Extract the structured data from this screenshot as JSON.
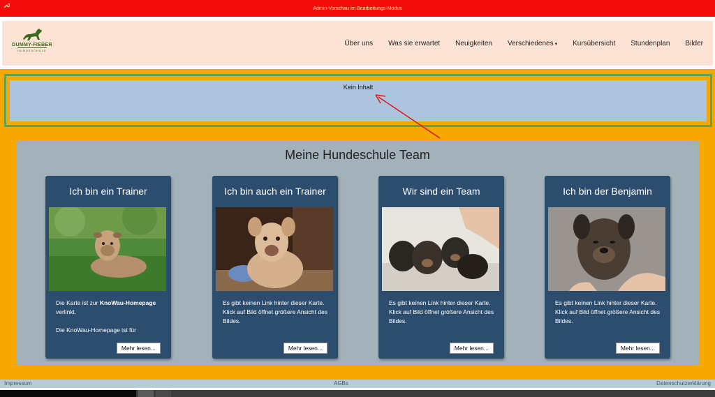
{
  "admin_bar": {
    "text": "Admin-Vorschau im Bearbeitungs-Modus",
    "icon": "wrench-icon"
  },
  "logo": {
    "brand": "DUMMY-FIEBER",
    "sub": "HUNDESCHULE"
  },
  "nav": {
    "items": [
      {
        "label": "Über uns"
      },
      {
        "label": "Was sie erwartet"
      },
      {
        "label": "Neuigkeiten"
      },
      {
        "label": "Verschiedenes"
      },
      {
        "label": "Kursübersicht"
      },
      {
        "label": "Stundenplan"
      },
      {
        "label": "Bilder"
      }
    ]
  },
  "empty_block": {
    "text": "Kein Inhalt"
  },
  "team": {
    "title": "Meine Hundeschule Team",
    "cards": [
      {
        "title": "Ich bin ein Trainer",
        "text_prefix": "Die Karte ist zur ",
        "text_bold": "KnoWau-Homepage",
        "text_suffix": " verlinkt.",
        "text_2": "Die KnoWau-Homepage ist für",
        "button": "Mehr lesen..."
      },
      {
        "title": "Ich bin auch ein Trainer",
        "text": "Es gibt keinen Link hinter dieser Karte. Klick auf Bild öffnet größere Ansicht des Bildes.",
        "button": "Mehr lesen..."
      },
      {
        "title": "Wir sind ein Team",
        "text": "Es gibt keinen Link hinter dieser Karte. Klick auf Bild öffnet größere Ansicht des Bildes.",
        "button": "Mehr lesen..."
      },
      {
        "title": "Ich bin der Benjamin",
        "text": "Es gibt keinen Link hinter dieser Karte. Klick auf Bild öffnet größere Ansicht des Bildes.",
        "button": "Mehr lesen..."
      }
    ]
  },
  "footer": {
    "left": "Impressum",
    "center": "AGBs",
    "right": "Datenschutzerklärung"
  },
  "colors": {
    "admin_bar": "#f20c0c",
    "navbar": "#fde3d6",
    "orange": "#f7a800",
    "green_border": "#5ea35a",
    "empty_block": "#adc4de",
    "section": "#a3b1bb",
    "card": "#2c4d6d",
    "arrow": "#e0161b"
  }
}
